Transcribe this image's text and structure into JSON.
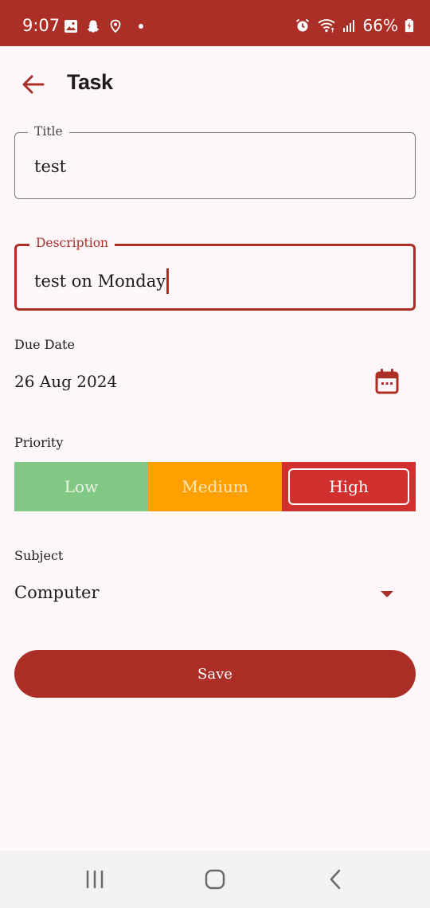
{
  "status_bar": {
    "time": "9:07",
    "battery": "66%",
    "left_icons": [
      "gallery-icon",
      "snapchat-icon",
      "location-icon",
      "dot-icon"
    ],
    "right_icons": [
      "alarm-icon",
      "wifi-icon",
      "signal-icon",
      "battery-icon"
    ]
  },
  "app_bar": {
    "title": "Task",
    "back_icon": "arrow-back-icon"
  },
  "form": {
    "title_field": {
      "label": "Title",
      "value": "test"
    },
    "description_field": {
      "label": "Description",
      "value": "test on Monday"
    },
    "due_date": {
      "label": "Due Date",
      "value": "26 Aug 2024",
      "icon": "calendar-icon"
    },
    "priority": {
      "label": "Priority",
      "options": [
        "Low",
        "Medium",
        "High"
      ],
      "selected": "High"
    },
    "subject": {
      "label": "Subject",
      "value": "Computer",
      "icon": "dropdown-arrow-icon"
    },
    "save_label": "Save"
  },
  "colors": {
    "primary": "#ab2f27",
    "background": "#fdf7fa",
    "low": "#80c884",
    "medium": "#ffa000",
    "high": "#d22f2f"
  },
  "nav_bar": {
    "icons": [
      "recents-icon",
      "home-icon",
      "back-icon"
    ]
  }
}
